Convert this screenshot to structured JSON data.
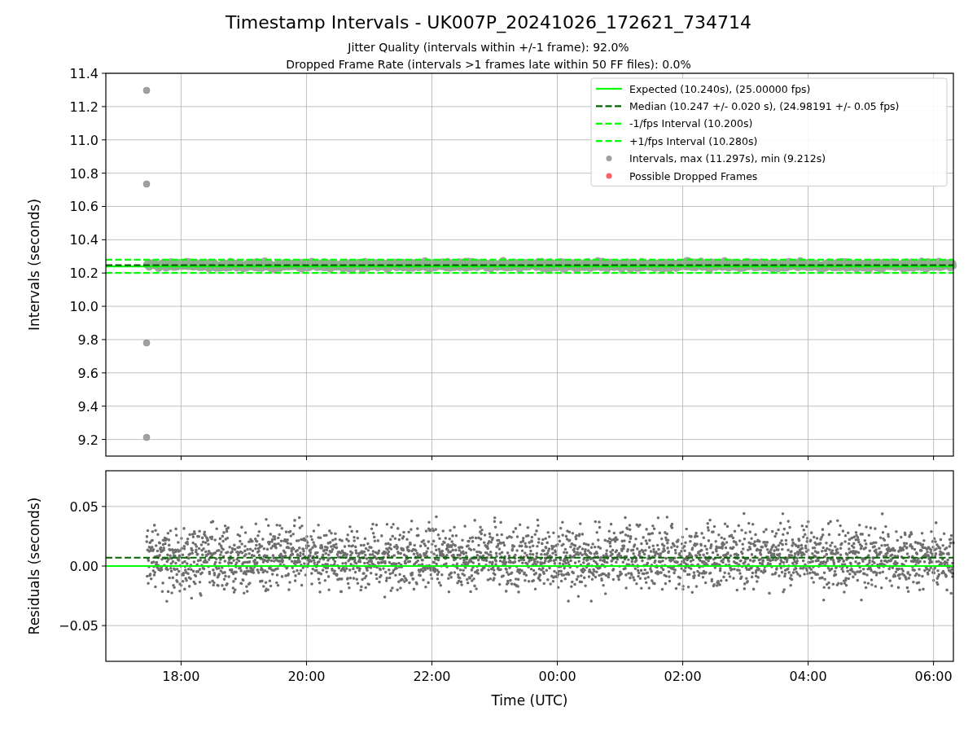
{
  "title": "Timestamp Intervals - UK007P_20241026_172621_734714",
  "subtitles": [
    "Jitter Quality (intervals within +/-1 frame): 92.0%",
    "Dropped Frame Rate (intervals >1 frames late within 50 FF files): 0.0%"
  ],
  "plots": [
    {
      "chart_data": {
        "type": "scatter",
        "ylabel": "Intervals (seconds)",
        "xlim": [
          "2024-10-26T16:48",
          "2024-10-27T06:19"
        ],
        "ylim": [
          9.1,
          11.4
        ],
        "yticks": [
          {
            "value": 9.2,
            "label": "9.2"
          },
          {
            "value": 9.4,
            "label": "9.4"
          },
          {
            "value": 9.6,
            "label": "9.6"
          },
          {
            "value": 9.8,
            "label": "9.8"
          },
          {
            "value": 10.0,
            "label": "10.0"
          },
          {
            "value": 10.2,
            "label": "10.2"
          },
          {
            "value": 10.4,
            "label": "10.4"
          },
          {
            "value": 10.6,
            "label": "10.6"
          },
          {
            "value": 10.8,
            "label": "10.8"
          },
          {
            "value": 11.0,
            "label": "11.0"
          },
          {
            "value": 11.2,
            "label": "11.2"
          },
          {
            "value": 11.4,
            "label": "11.4"
          }
        ],
        "ref_lines": [
          {
            "axis": "y",
            "value": 10.24,
            "label": "Expected (10.240s), (25.00000 fps)",
            "color": "#00ff00"
          },
          {
            "axis": "y",
            "value": 10.247,
            "label": "Median (10.247 +/- 0.020 s), (24.98191 +/- 0.05 fps)",
            "color": "#006400"
          },
          {
            "axis": "y",
            "value": 10.2,
            "label": "-1/fps Interval (10.200s)",
            "color": "#00ff00"
          },
          {
            "axis": "y",
            "value": 10.28,
            "label": "+1/fps Interval (10.280s)",
            "color": "#00ff00"
          }
        ],
        "grid": true,
        "legend": true,
        "series": [
          {
            "name": "Intervals, max (11.297s), min (9.212s)",
            "color": "#a0a0a0",
            "x": [
              "2024-10-26T17:27",
              "2024-10-26T17:27",
              "2024-10-26T17:27",
              "2024-10-26T17:27"
            ],
            "values": [
              11.297,
              10.735,
              9.78,
              9.212
            ]
          },
          {
            "name": "Possible Dropped Frames",
            "color": "#ff6060"
          }
        ]
      }
    },
    {
      "chart_data": {
        "type": "scatter",
        "xlabel": "Time (UTC)",
        "ylabel": "Residuals (seconds)",
        "xlim": [
          "2024-10-26T16:48",
          "2024-10-27T06:19"
        ],
        "ylim": [
          -0.08,
          0.08
        ],
        "xticks": [
          {
            "value": "2024-10-26T18:00",
            "label": "18:00"
          },
          {
            "value": "2024-10-26T20:00",
            "label": "20:00"
          },
          {
            "value": "2024-10-26T22:00",
            "label": "22:00"
          },
          {
            "value": "2024-10-27T00:00",
            "label": "00:00"
          },
          {
            "value": "2024-10-27T02:00",
            "label": "02:00"
          },
          {
            "value": "2024-10-27T04:00",
            "label": "04:00"
          },
          {
            "value": "2024-10-27T06:00",
            "label": "06:00"
          }
        ],
        "yticks": [
          {
            "value": -0.05,
            "label": "−0.05"
          },
          {
            "value": 0,
            "label": "0.00"
          },
          {
            "value": 0.05,
            "label": "0.05"
          }
        ],
        "ref_lines": [
          {
            "axis": "y",
            "value": 0,
            "color": "#00ff00"
          },
          {
            "axis": "y",
            "value": 0.007,
            "color": "#006400"
          }
        ],
        "grid": true
      }
    }
  ]
}
